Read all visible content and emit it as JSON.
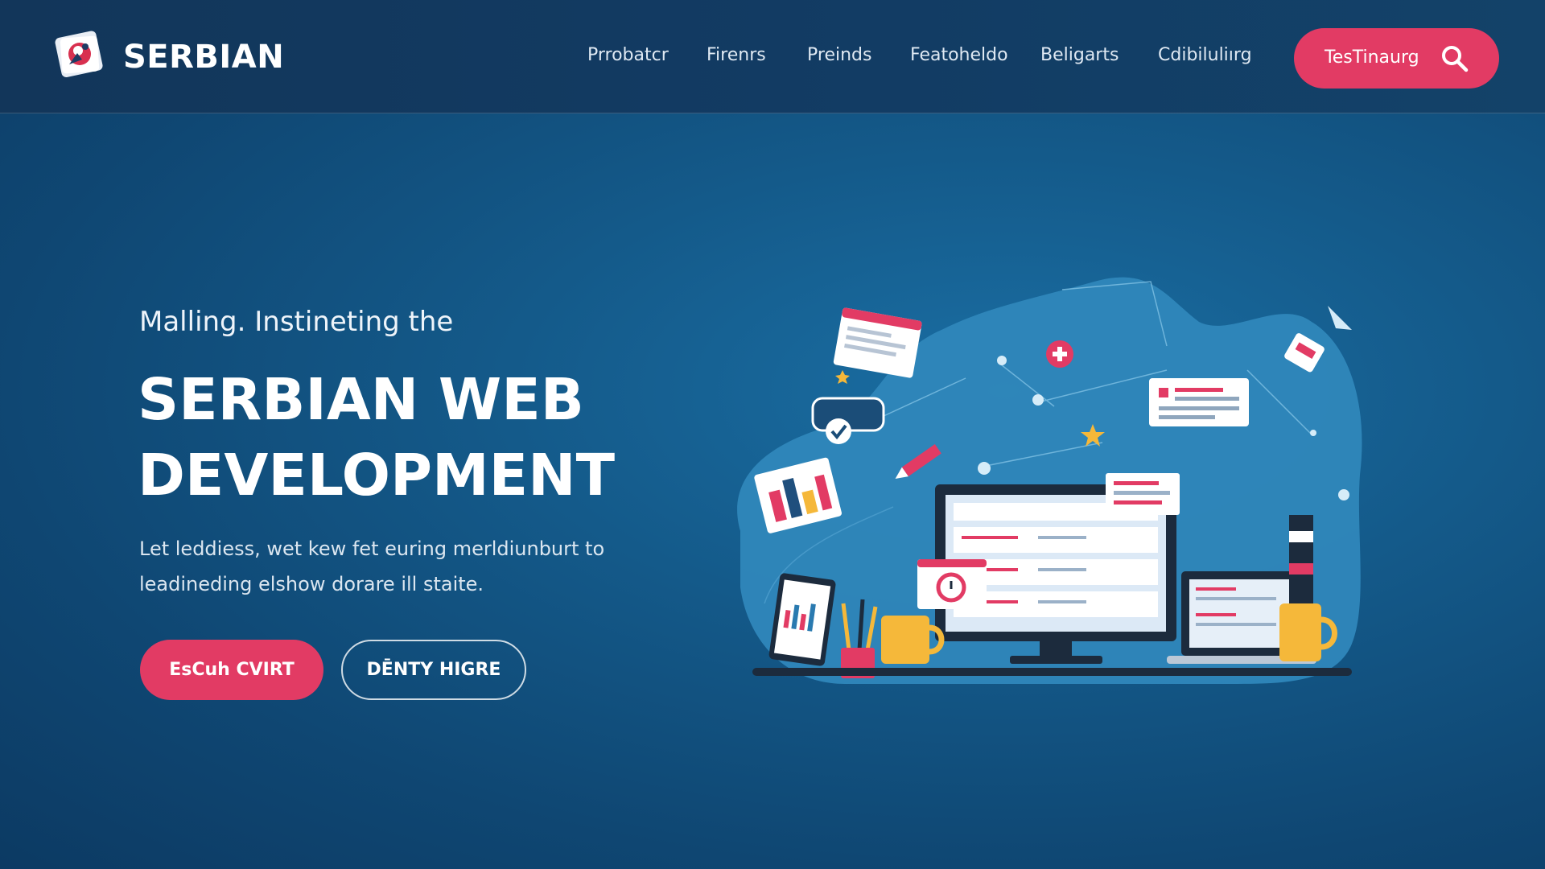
{
  "header": {
    "brand": "SERBIAN",
    "nav": [
      "Prrobatcr",
      "Firenrs",
      "Preinds",
      "Featoheldo",
      "Beligarts",
      "Cdibiluliırg"
    ],
    "cta_label": "TesTinaurg",
    "cta_icon": "search-icon"
  },
  "hero": {
    "kicker": "Malling. Instineting the",
    "title_line1": "SERBIAN WEB",
    "title_line2": "DEVELOPMENT",
    "description": "Let leddiess, wet kew fet euring merldiunburt to leadineding elshow dorare ill staite.",
    "primary_button": "EsCuh CVIRT",
    "secondary_button": "DĒNTY HIGRE"
  },
  "colors": {
    "accent": "#e23b64",
    "background": "#145a8a",
    "nav_background": "#123b63"
  },
  "illustration": {
    "icons": [
      "monitor-icon",
      "laptop-icon",
      "tablet-icon",
      "coffee-mug-icon",
      "pencil-cup-icon",
      "chart-card-icon",
      "browser-window-icon",
      "checkmark-icon",
      "star-icon",
      "clock-icon",
      "plus-icon",
      "pencil-icon",
      "paper-plane-icon"
    ]
  }
}
